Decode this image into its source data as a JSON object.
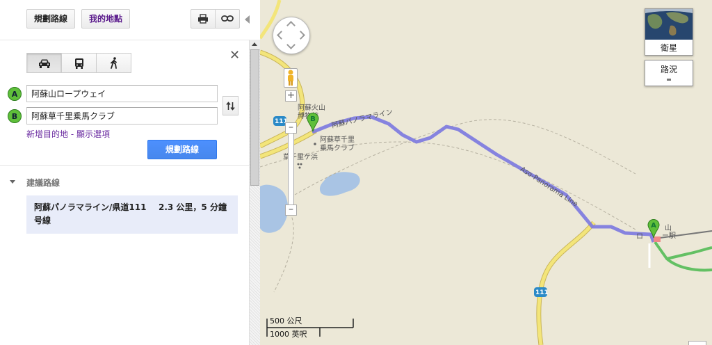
{
  "toolbar": {
    "route_label": "規劃路線",
    "places_label": "我的地點"
  },
  "directions": {
    "start": "阿蘇山ロープウェイ",
    "end": "阿蘇草千里乗馬クラブ",
    "marker_a": "A",
    "marker_b": "B",
    "add_destination": "新增目的地",
    "separator": " - ",
    "show_options": "顯示選項",
    "submit_label": "規劃路線"
  },
  "suggested": {
    "title": "建議路線",
    "route_name": "阿蘇パノラマライン/県道111号線",
    "route_info": "2.3 公里，5 分鐘"
  },
  "map": {
    "labels": {
      "volcano_museum": "阿蘇火山\n博物館",
      "riding_club": "阿蘇草千里\n乗馬クラブ",
      "kusasenri": "草千里ケ浜",
      "panorama_jp": "阿蘇パノラマライン",
      "panorama_en": "Aso-Panorama Line",
      "station_partial": "ロ",
      "station_right": "ー駅",
      "mountain_partial": "山",
      "road_111_a": "111",
      "road_111_b": "111"
    },
    "maptype_satellite": "衛星",
    "maptype_traffic": "路況",
    "scale_metric": "500 公尺",
    "scale_imperial": "1000 英呎"
  },
  "colors": {
    "route": "#7b78e0",
    "marker_green": "#5fbf3a",
    "submit_blue": "#4d90fe",
    "road_yellow": "#f3e57a",
    "lake_blue": "#a9c4e4"
  },
  "icons": {
    "print": "printer-icon",
    "link": "link-icon",
    "car": "car-icon",
    "bus": "bus-icon",
    "walk": "walk-icon",
    "swap": "swap-icon",
    "close": "close-icon"
  }
}
